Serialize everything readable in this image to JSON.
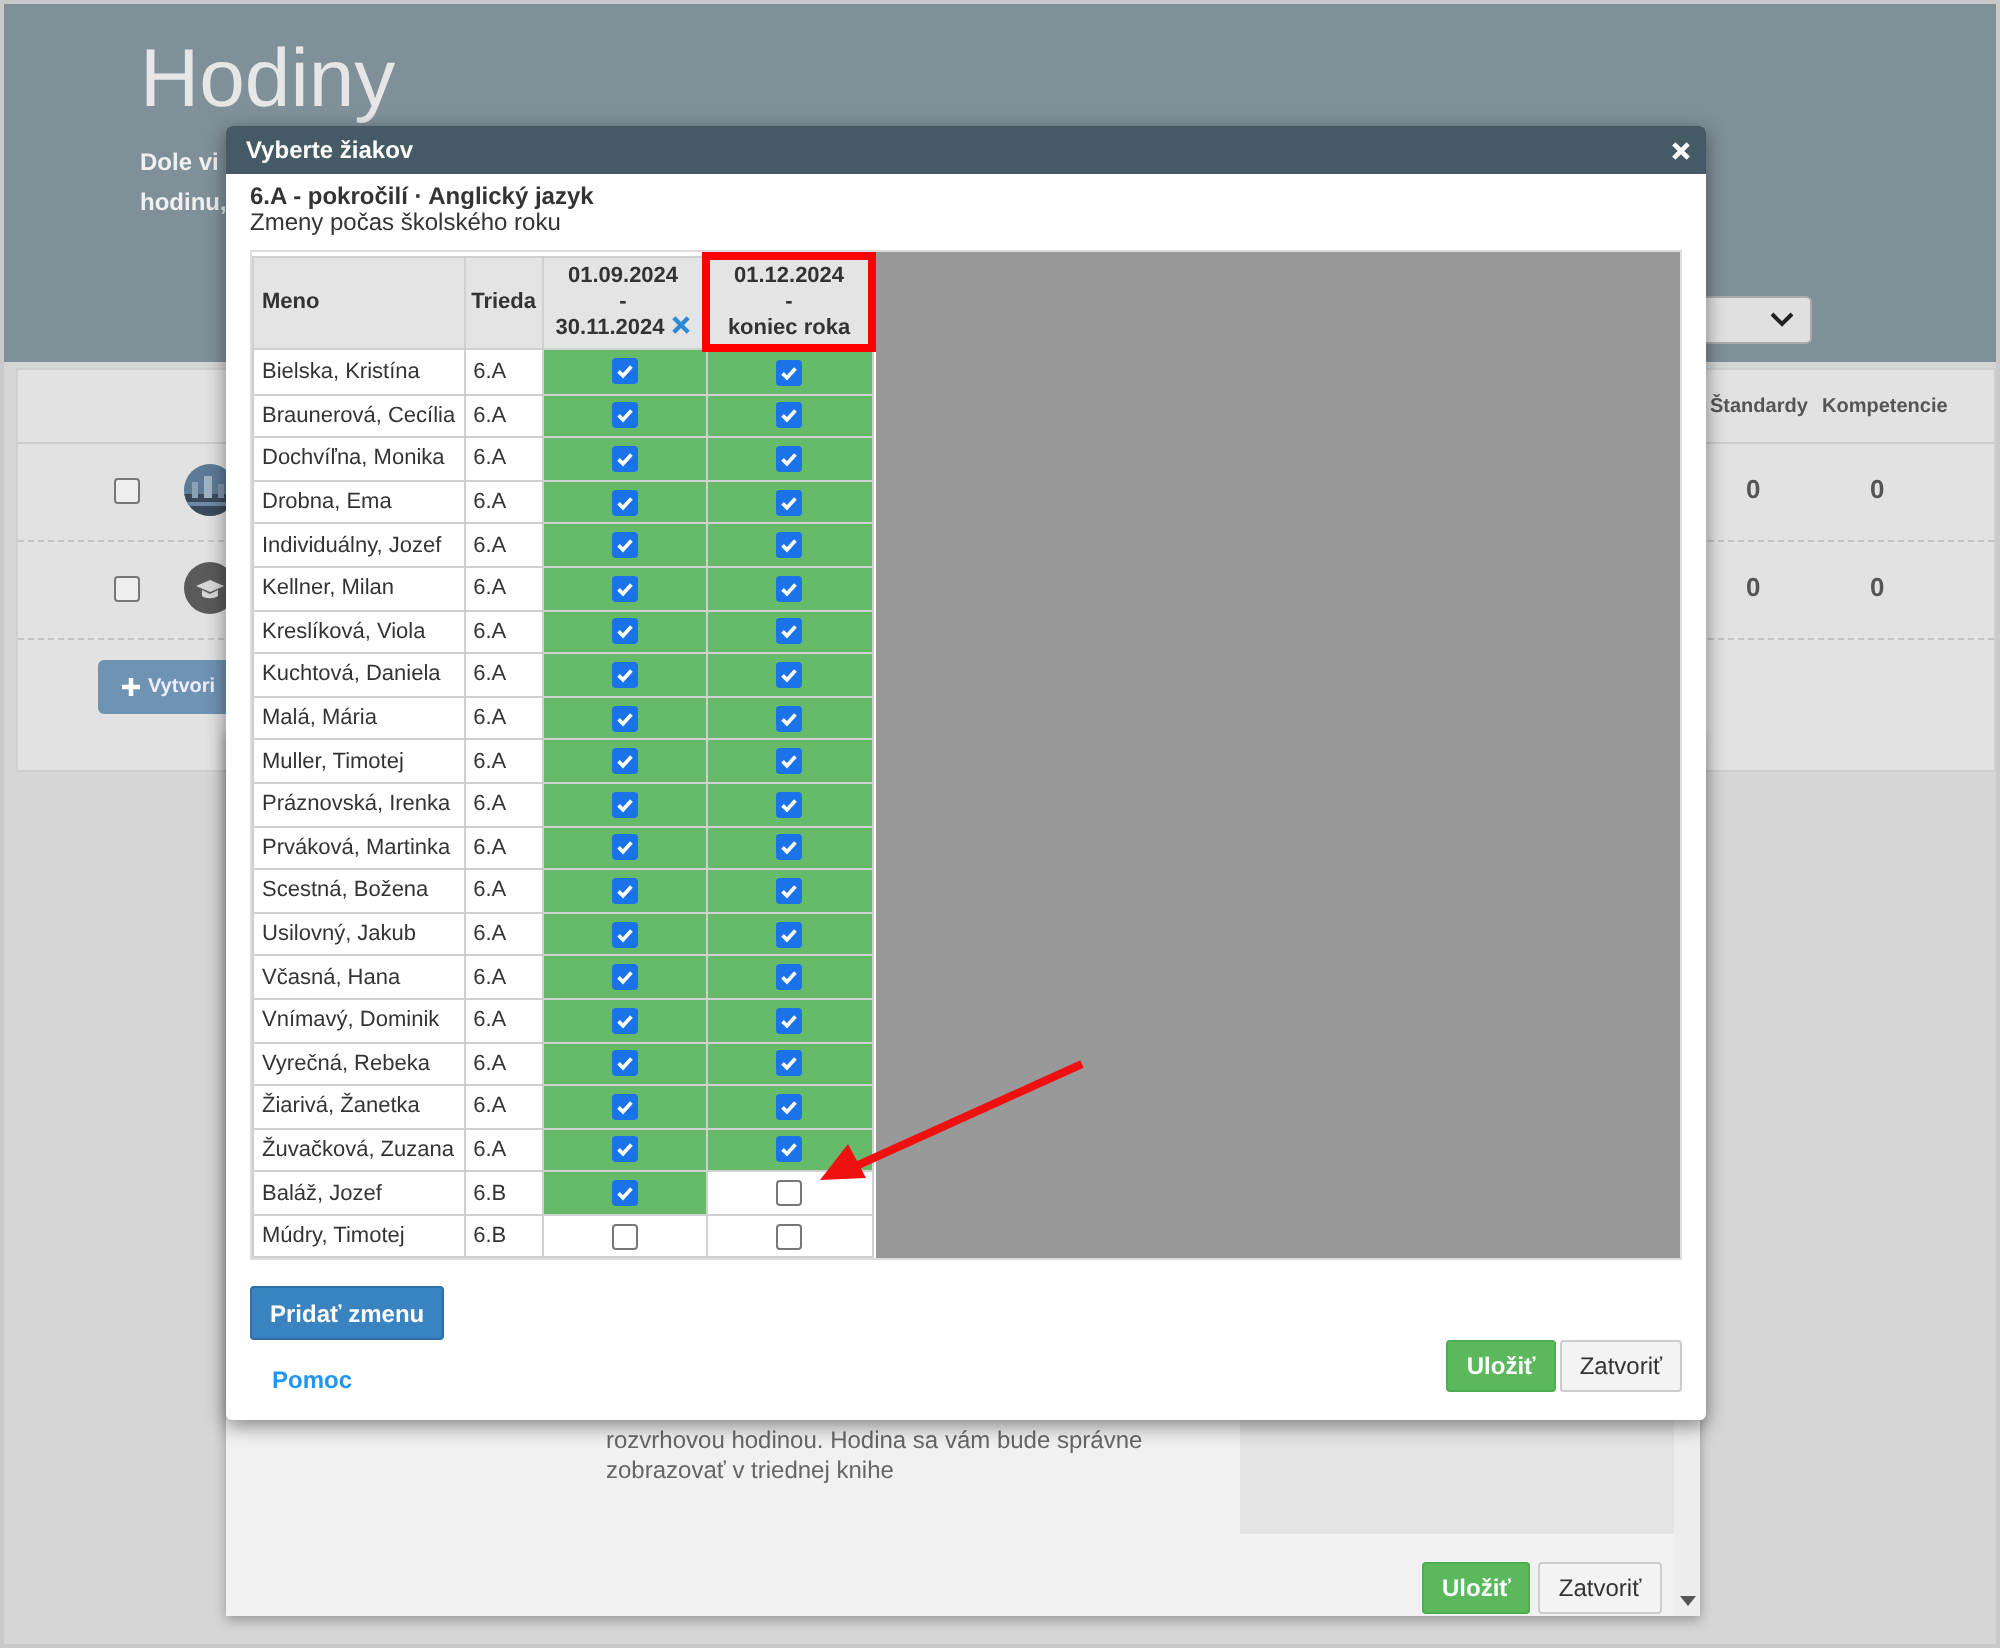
{
  "page": {
    "title": "Hodiny",
    "intro_lines": [
      "Dole vi",
      "hodinu,"
    ],
    "columns": [
      "Štandardy",
      "Kompetencie"
    ],
    "rows": [
      {
        "kind": "picture",
        "checked": false,
        "values": [
          "0",
          "0"
        ]
      },
      {
        "kind": "cap",
        "checked": false,
        "values": [
          "0",
          "0"
        ]
      }
    ],
    "create_button": "Vytvori"
  },
  "back_dialog": {
    "help_text": "rozvrhovou hodinou. Hodina sa vám bude správne zobrazovať v triednej knihe",
    "buttons": [
      "Uložiť",
      "Zatvoriť"
    ]
  },
  "dialog": {
    "title": "Vyberte žiakov",
    "group": "6.A - pokročilí · Anglický jazyk",
    "subtitle": "Zmeny počas školského roku",
    "columns": [
      "Meno",
      "Trieda"
    ],
    "periods": [
      {
        "from": "01.09.2024",
        "separator": "-",
        "to": "30.11.2024",
        "removable": true,
        "highlighted": false
      },
      {
        "from": "01.12.2024",
        "separator": "-",
        "to": "koniec roka",
        "removable": false,
        "highlighted": true
      }
    ],
    "students": [
      {
        "name": "Bielska, Kristína",
        "class": "6.A",
        "periods": [
          true,
          true
        ]
      },
      {
        "name": "Braunerová, Cecília",
        "class": "6.A",
        "periods": [
          true,
          true
        ]
      },
      {
        "name": "Dochvíľna, Monika",
        "class": "6.A",
        "periods": [
          true,
          true
        ]
      },
      {
        "name": "Drobna, Ema",
        "class": "6.A",
        "periods": [
          true,
          true
        ]
      },
      {
        "name": "Individuálny, Jozef",
        "class": "6.A",
        "periods": [
          true,
          true
        ]
      },
      {
        "name": "Kellner, Milan",
        "class": "6.A",
        "periods": [
          true,
          true
        ]
      },
      {
        "name": "Kreslíková, Viola",
        "class": "6.A",
        "periods": [
          true,
          true
        ]
      },
      {
        "name": "Kuchtová, Daniela",
        "class": "6.A",
        "periods": [
          true,
          true
        ]
      },
      {
        "name": "Malá, Mária",
        "class": "6.A",
        "periods": [
          true,
          true
        ]
      },
      {
        "name": "Muller, Timotej",
        "class": "6.A",
        "periods": [
          true,
          true
        ]
      },
      {
        "name": "Práznovská, Irenka",
        "class": "6.A",
        "periods": [
          true,
          true
        ]
      },
      {
        "name": "Prváková, Martinka",
        "class": "6.A",
        "periods": [
          true,
          true
        ]
      },
      {
        "name": "Scestná, Božena",
        "class": "6.A",
        "periods": [
          true,
          true
        ]
      },
      {
        "name": "Usilovný, Jakub",
        "class": "6.A",
        "periods": [
          true,
          true
        ]
      },
      {
        "name": "Včasná, Hana",
        "class": "6.A",
        "periods": [
          true,
          true
        ]
      },
      {
        "name": "Vnímavý, Dominik",
        "class": "6.A",
        "periods": [
          true,
          true
        ]
      },
      {
        "name": "Vyrečná, Rebeka",
        "class": "6.A",
        "periods": [
          true,
          true
        ]
      },
      {
        "name": "Žiarivá, Žanetka",
        "class": "6.A",
        "periods": [
          true,
          true
        ]
      },
      {
        "name": "Žuvačková, Zuzana",
        "class": "6.A",
        "periods": [
          true,
          true
        ]
      },
      {
        "name": "Baláž, Jozef",
        "class": "6.B",
        "periods": [
          true,
          false
        ]
      },
      {
        "name": "Múdry, Timotej",
        "class": "6.B",
        "periods": [
          false,
          false
        ]
      }
    ],
    "add_button": "Pridať zmenu",
    "help_link": "Pomoc",
    "save_button": "Uložiť",
    "close_button": "Zatvoriť"
  }
}
